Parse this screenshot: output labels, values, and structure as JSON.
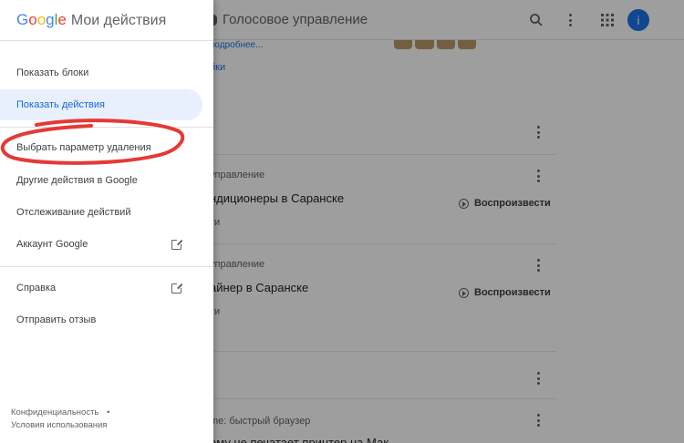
{
  "app": {
    "logo": "Google",
    "title": "Мои действия"
  },
  "topbar": {
    "title": "Голосовое управление",
    "avatar_letter": "i"
  },
  "drawer": {
    "items": [
      {
        "label": "Показать блоки"
      },
      {
        "label": "Показать действия"
      },
      {
        "label": "Выбрать параметр удаления"
      },
      {
        "label": "Другие действия в Google"
      },
      {
        "label": "Отслеживание действий"
      },
      {
        "label": "Аккаунт Google"
      },
      {
        "label": "Справка"
      },
      {
        "label": "Отправить отзыв"
      }
    ],
    "footer": {
      "privacy": "Конфиденциальность",
      "bullet": "•",
      "terms": "Условия использования"
    }
  },
  "feed": {
    "partial_link_1": "подробнее...",
    "partial_link_2": "йки",
    "cards": [
      {
        "meta": "управление",
        "heading": "ндиционеры в Саранске",
        "sub": "ти",
        "play": "Воспроизвести"
      },
      {
        "meta": "управление",
        "heading": "айнер в Саранске",
        "sub": "ти",
        "play": "Воспроизвести"
      },
      {
        "meta": "me: быстрый браузер",
        "heading": "ему не печатает принтер на Мак"
      }
    ]
  },
  "colors": {
    "accent": "#1a73e8",
    "active_bg": "#e8f0fe",
    "marker": "#e53935"
  }
}
